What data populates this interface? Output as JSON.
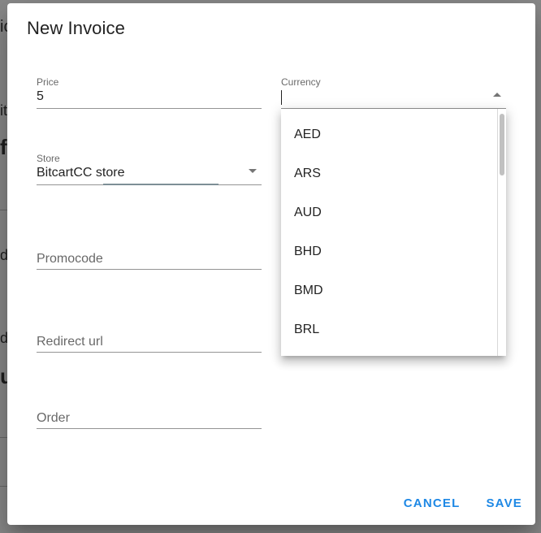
{
  "background": {
    "fragments": [
      "ic",
      "it",
      "fi",
      "d",
      "d",
      "u"
    ]
  },
  "dialog": {
    "title": "New Invoice",
    "price": {
      "label": "Price",
      "value": "5"
    },
    "currency": {
      "label": "Currency",
      "value": ""
    },
    "store": {
      "label": "Store",
      "value": "BitcartCC store"
    },
    "promocode": {
      "placeholder": "Promocode"
    },
    "redirect_url": {
      "placeholder": "Redirect url"
    },
    "order": {
      "placeholder": "Order"
    },
    "actions": {
      "cancel": "CANCEL",
      "save": "SAVE"
    }
  },
  "currency_menu": {
    "options": [
      "AED",
      "ARS",
      "AUD",
      "BHD",
      "BMD",
      "BRL"
    ]
  },
  "colors": {
    "accent": "#1e88e5",
    "overlay": "#8a8a8a"
  }
}
